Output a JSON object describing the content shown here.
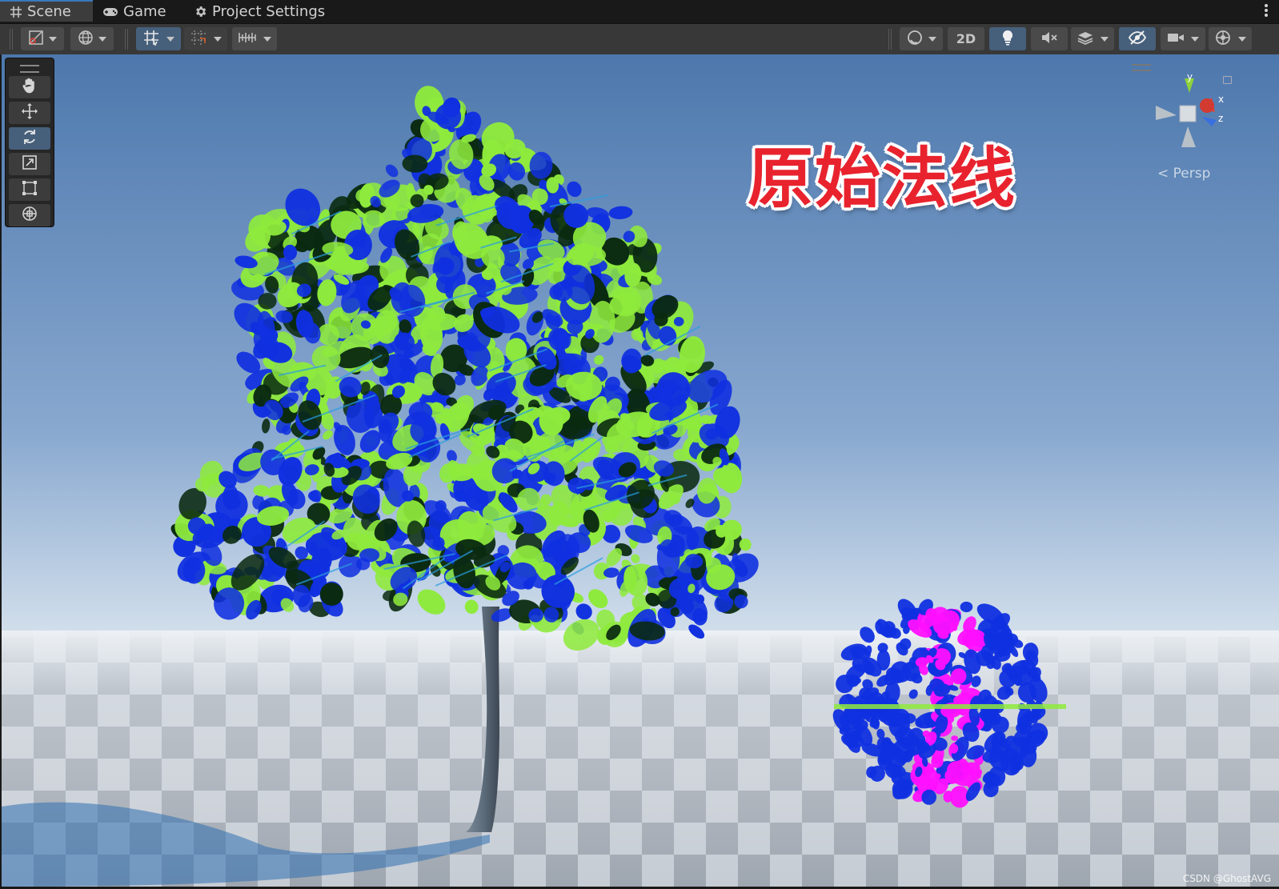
{
  "tabs": [
    {
      "label": "Scene",
      "icon": "grid-hash-icon",
      "active": true
    },
    {
      "label": "Game",
      "icon": "gamepad-icon",
      "active": false
    },
    {
      "label": "Project Settings",
      "icon": "gear-icon",
      "active": false
    }
  ],
  "toolbar": {
    "toggle_2d_label": "2D"
  },
  "scene": {
    "overlay_title": "原始法线",
    "gizmo": {
      "axis_y": "y",
      "axis_x": "x",
      "axis_z": "z"
    },
    "projection_label": "Persp",
    "watermark": "CSDN @GhostAVG"
  },
  "colors": {
    "accent": "#3a79bb",
    "overlay_text": "#e8232e",
    "foliage_green": "#8eea3c",
    "foliage_blue": "#1030e0",
    "foliage_dark": "#0a2a10",
    "magenta": "#ff10ff"
  }
}
